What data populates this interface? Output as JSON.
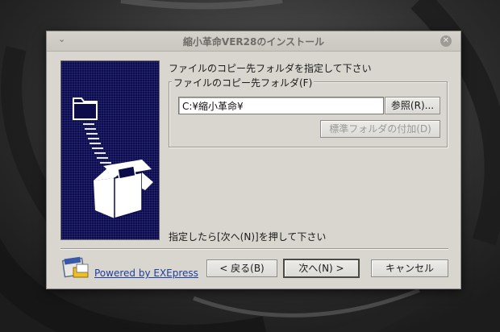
{
  "window": {
    "title": "縮小革命VER28のインストール",
    "menu_glyph": "⌄",
    "close_glyph": "✕"
  },
  "main": {
    "instruction": "ファイルのコピー先フォルダを指定して下さい",
    "group_label": "ファイルのコピー先フォルダ(F)",
    "path_value": "C:¥縮小革命¥",
    "browse_button": "参照(R)...",
    "standard_folder_button": "標準フォルダの付加(D)",
    "prompt": "指定したら[次へ(N)]を押して下さい"
  },
  "footer": {
    "powered_by": "Powered by EXEpress",
    "back_button": "< 戻る(B)",
    "next_button": "次へ(N) >",
    "cancel_button": "キャンセル"
  },
  "icons": {
    "side_image": "folder-into-box-icon",
    "logo": "exepress-logo-icon"
  },
  "colors": {
    "side_panel_bg": "#0c0c4a",
    "dialog_bg": "#d9d6d0",
    "link": "#1e3fa0"
  }
}
